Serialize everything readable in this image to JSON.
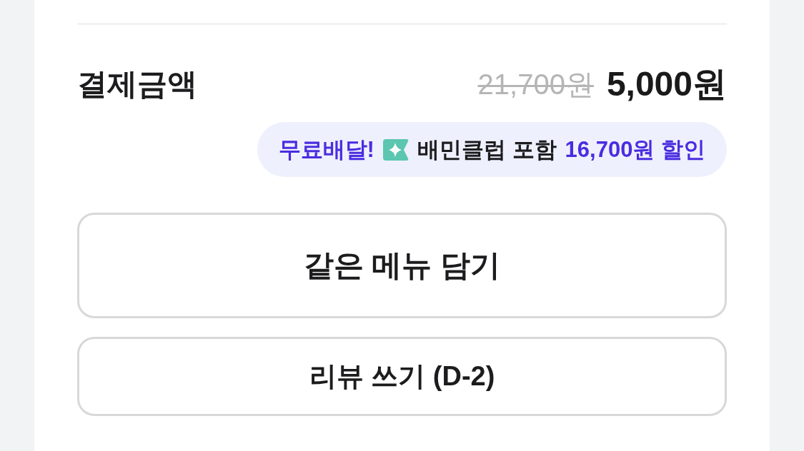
{
  "payment": {
    "label": "결제금액",
    "original_price": "21,700원",
    "price": "5,000원"
  },
  "promo": {
    "free_delivery": "무료배달!",
    "club_text": "배민클럽 포함",
    "discount": "16,700원 할인"
  },
  "buttons": [
    {
      "label": "같은 메뉴 담기",
      "kind": "primary"
    },
    {
      "label": "리뷰 쓰기 (D-2)",
      "kind": "secondary"
    }
  ]
}
